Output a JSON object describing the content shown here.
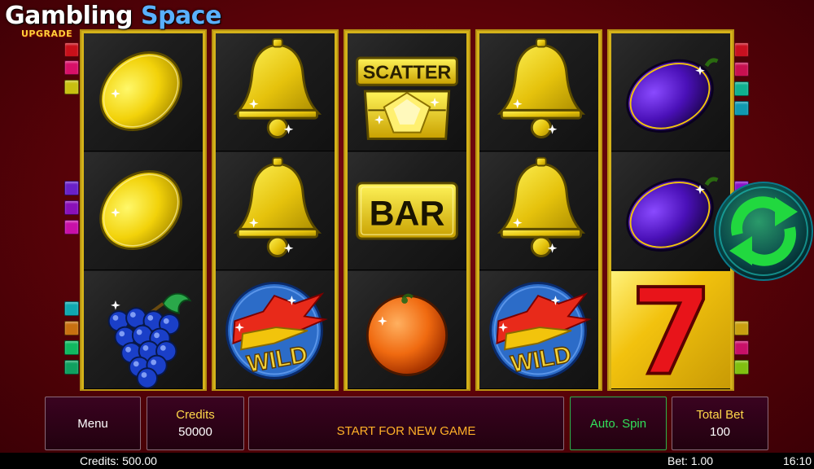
{
  "logo": {
    "brand_part1": "Gambling",
    "brand_part2": "Space",
    "sub": "UPGRADE"
  },
  "reels": [
    [
      "lemon",
      "lemon",
      "grapes"
    ],
    [
      "bell",
      "bell",
      "wild"
    ],
    [
      "scatter",
      "bar",
      "orange"
    ],
    [
      "bell",
      "bell",
      "wild"
    ],
    [
      "plum",
      "plum",
      "seven"
    ]
  ],
  "symbol_text": {
    "scatter": "SCATTER",
    "bar": "BAR",
    "wild": "WILD",
    "seven": "7"
  },
  "payline_colors": {
    "left": [
      "#c8101a",
      "#d81068",
      "#c8c010",
      "#6a20c8",
      "#8a10b8",
      "#c810a8",
      "#10a8b0",
      "#c87010",
      "#10b860",
      "#10a060"
    ],
    "right": [
      "#c81020",
      "#c81050",
      "#10b090",
      "#1098b0",
      "#8a10c8",
      "#c8a010",
      "#c81068",
      "#80c010"
    ]
  },
  "buttons": {
    "menu": "Menu",
    "credits_label": "Credits",
    "credits_value": "50000",
    "message": "START FOR NEW GAME",
    "auto_spin": "Auto. Spin",
    "total_bet_label": "Total Bet",
    "total_bet_value": "100"
  },
  "status": {
    "credits": "Credits: 500.00",
    "bet": "Bet: 1.00",
    "time": "16:10"
  },
  "colors": {
    "background": "#5a0208",
    "reel_frame": "#d4b21a",
    "gold": "#f2cc10",
    "accent_green": "#31e15a",
    "message_orange": "#ffb028"
  },
  "icons": {
    "spin": "refresh-arrows-icon"
  }
}
